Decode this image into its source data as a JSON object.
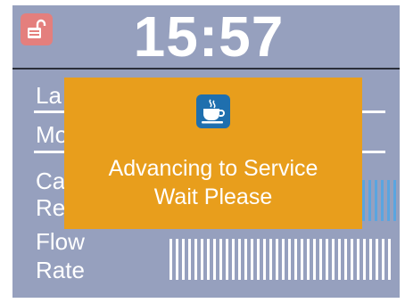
{
  "header": {
    "time": "15:57",
    "lock_icon": "unlocked-padlock-icon"
  },
  "rows": {
    "row1_label": "La",
    "row2_label": "Mo",
    "row3_label_line1": "Ca",
    "row3_label_line2": "Re",
    "row4_label_line1": "Flow",
    "row4_label_line2": "Rate"
  },
  "dialog": {
    "icon": "coffee-cup-icon",
    "line1": "Advancing to Service",
    "line2": "Wait Please"
  },
  "colors": {
    "screen_bg": "#96a0be",
    "dialog_bg": "#e89e1c",
    "lock_button": "#e47f7d",
    "dialog_icon_bg": "#1f6fae",
    "bar_blue": "#5aa5e0",
    "bar_white": "#ffffff"
  }
}
